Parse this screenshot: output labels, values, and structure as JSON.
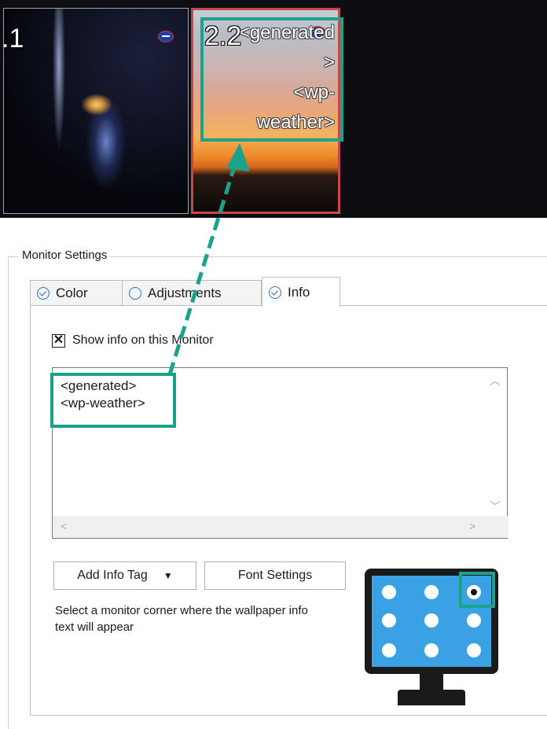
{
  "preview": {
    "monitor1_label": ".1",
    "monitor2_label": "2.2",
    "overlay_lines": [
      "<generated",
      ">",
      "<wp-",
      "weather>"
    ]
  },
  "monitor_settings": {
    "title": "Monitor Settings",
    "tabs": [
      {
        "label": "Color",
        "icon": "check-circle-icon"
      },
      {
        "label": "Adjustments",
        "icon": "empty-circle-icon"
      },
      {
        "label": "Info",
        "icon": "check-circle-icon",
        "active": true
      }
    ],
    "show_info_checkbox": {
      "label": "Show info on this Monitor",
      "checked": true
    },
    "info_text_lines": [
      "<generated>",
      "<wp-weather>"
    ],
    "add_info_tag_label": "Add Info Tag",
    "font_settings_label": "Font Settings",
    "corner_hint": "Select a monitor corner where the wallpaper info text will appear",
    "selected_corner": "top-right"
  },
  "colors": {
    "highlight": "#1aa38a",
    "selected_monitor_border": "#c44a4a",
    "picker_screen": "#3aa1e4"
  }
}
